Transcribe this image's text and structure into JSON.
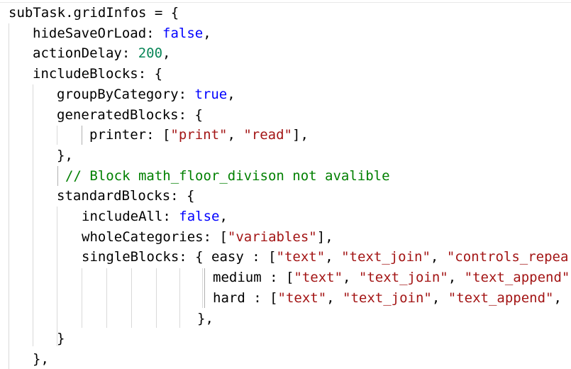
{
  "code_editor": {
    "colors": {
      "keyword": "#0000ff",
      "number": "#098658",
      "string": "#a31515",
      "comment": "#008000",
      "text": "#000000",
      "background": "#ffffff"
    },
    "lines": [
      [
        {
          "t": "subTask.gridInfos = {",
          "c": "plain"
        }
      ],
      [
        {
          "t": "hideSaveOrLoad: ",
          "c": "plain"
        },
        {
          "t": "false",
          "c": "kw"
        },
        {
          "t": ",",
          "c": "plain"
        }
      ],
      [
        {
          "t": "actionDelay: ",
          "c": "plain"
        },
        {
          "t": "200",
          "c": "num"
        },
        {
          "t": ",",
          "c": "plain"
        }
      ],
      [
        {
          "t": "includeBlocks: {",
          "c": "plain"
        }
      ],
      [
        {
          "t": "groupByCategory: ",
          "c": "plain"
        },
        {
          "t": "true",
          "c": "kw"
        },
        {
          "t": ",",
          "c": "plain"
        }
      ],
      [
        {
          "t": "generatedBlocks: {",
          "c": "plain"
        }
      ],
      [
        {
          "t": "printer: [",
          "c": "plain"
        },
        {
          "t": "\"print\"",
          "c": "str"
        },
        {
          "t": ", ",
          "c": "plain"
        },
        {
          "t": "\"read\"",
          "c": "str"
        },
        {
          "t": "],",
          "c": "plain"
        }
      ],
      [
        {
          "t": "},",
          "c": "plain"
        }
      ],
      [
        {
          "t": "// Block math_floor_divison not avalible",
          "c": "cmt"
        }
      ],
      [
        {
          "t": "standardBlocks: {",
          "c": "plain"
        }
      ],
      [
        {
          "t": "includeAll: ",
          "c": "plain"
        },
        {
          "t": "false",
          "c": "kw"
        },
        {
          "t": ",",
          "c": "plain"
        }
      ],
      [
        {
          "t": "wholeCategories: [",
          "c": "plain"
        },
        {
          "t": "\"variables\"",
          "c": "str"
        },
        {
          "t": "],",
          "c": "plain"
        }
      ],
      [
        {
          "t": "singleBlocks: { easy : [",
          "c": "plain"
        },
        {
          "t": "\"text\"",
          "c": "str"
        },
        {
          "t": ", ",
          "c": "plain"
        },
        {
          "t": "\"text_join\"",
          "c": "str"
        },
        {
          "t": ", ",
          "c": "plain"
        },
        {
          "t": "\"controls_repea",
          "c": "str"
        }
      ],
      [
        {
          "t": "medium : [",
          "c": "plain"
        },
        {
          "t": "\"text\"",
          "c": "str"
        },
        {
          "t": ", ",
          "c": "plain"
        },
        {
          "t": "\"text_join\"",
          "c": "str"
        },
        {
          "t": ", ",
          "c": "plain"
        },
        {
          "t": "\"text_append\"",
          "c": "str"
        }
      ],
      [
        {
          "t": "hard : [",
          "c": "plain"
        },
        {
          "t": "\"text\"",
          "c": "str"
        },
        {
          "t": ", ",
          "c": "plain"
        },
        {
          "t": "\"text_join\"",
          "c": "str"
        },
        {
          "t": ", ",
          "c": "plain"
        },
        {
          "t": "\"text_append\"",
          "c": "str"
        },
        {
          "t": ",",
          "c": "plain"
        }
      ],
      [
        {
          "t": "},",
          "c": "plain"
        }
      ],
      [
        {
          "t": "}",
          "c": "plain"
        }
      ],
      [
        {
          "t": "},",
          "c": "plain"
        }
      ]
    ]
  }
}
